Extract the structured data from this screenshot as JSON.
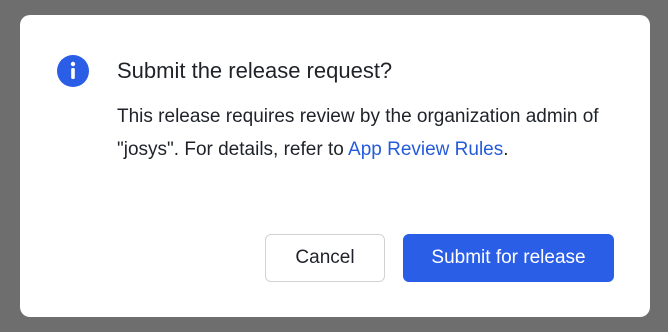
{
  "dialog": {
    "title": "Submit the release request?",
    "message_prefix": "This release requires review by the organization admin of \"josys\". For details, refer to ",
    "link_text": "App Review Rules",
    "message_suffix": ".",
    "cancel_label": "Cancel",
    "submit_label": "Submit for release",
    "icon": "info-icon"
  },
  "colors": {
    "overlay": "#6e6e6e",
    "accent": "#2b5ee6",
    "link": "#245bdb",
    "text": "#1f2329"
  }
}
